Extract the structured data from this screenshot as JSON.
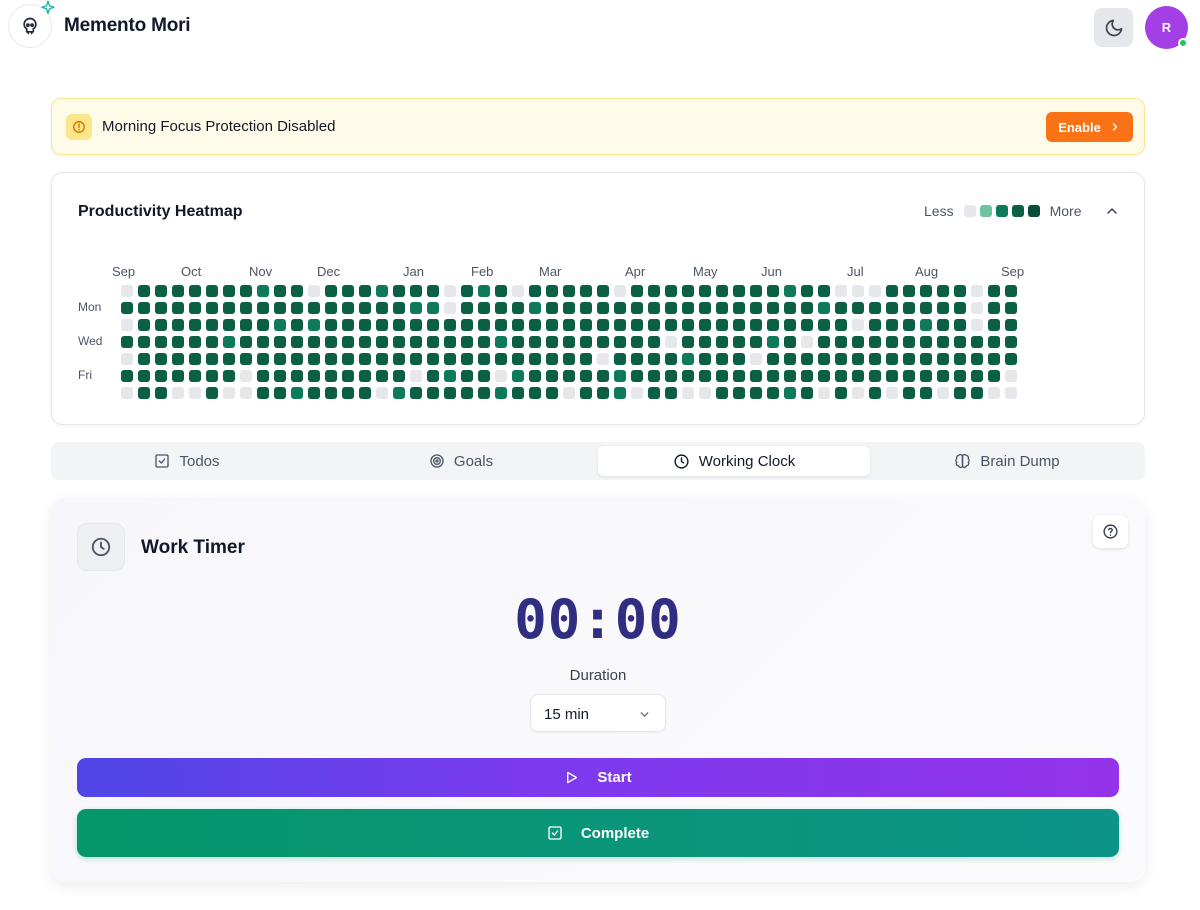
{
  "app": {
    "title": "Memento Mori",
    "avatar_initial": "R"
  },
  "colors": {
    "accent_orange": "#f97316",
    "heat_levels": [
      "#e5e7eb",
      "#6fc3a0",
      "#0f7a5a",
      "#0b5f45",
      "#064e3b"
    ]
  },
  "alert": {
    "text": "Morning Focus Protection Disabled",
    "button_label": "Enable"
  },
  "heatmap": {
    "title": "Productivity Heatmap",
    "legend_less": "Less",
    "legend_more": "More",
    "months": [
      "Sep",
      "Oct",
      "Nov",
      "Dec",
      "Jan",
      "Feb",
      "Mar",
      "Apr",
      "May",
      "Jun",
      "Jul",
      "Aug",
      "Sep"
    ],
    "day_labels": [
      "Mon",
      "Wed",
      "Fri"
    ],
    "weeks": [
      [
        0,
        3,
        0,
        3,
        0,
        3,
        0
      ],
      [
        3,
        3,
        3,
        3,
        3,
        3,
        3
      ],
      [
        3,
        3,
        3,
        3,
        3,
        3,
        3
      ],
      [
        3,
        3,
        3,
        3,
        3,
        3,
        0
      ],
      [
        3,
        3,
        3,
        3,
        3,
        3,
        0
      ],
      [
        3,
        3,
        3,
        3,
        3,
        3,
        3
      ],
      [
        3,
        3,
        3,
        2,
        3,
        3,
        0
      ],
      [
        3,
        3,
        3,
        3,
        3,
        0,
        0
      ],
      [
        2,
        3,
        3,
        3,
        3,
        3,
        3
      ],
      [
        3,
        3,
        2,
        3,
        3,
        3,
        3
      ],
      [
        3,
        3,
        3,
        3,
        3,
        3,
        2
      ],
      [
        0,
        3,
        2,
        3,
        3,
        3,
        3
      ],
      [
        3,
        3,
        3,
        3,
        3,
        3,
        3
      ],
      [
        3,
        3,
        3,
        3,
        3,
        3,
        3
      ],
      [
        3,
        3,
        3,
        3,
        3,
        3,
        3
      ],
      [
        2,
        3,
        3,
        3,
        3,
        3,
        0
      ],
      [
        3,
        3,
        3,
        3,
        3,
        3,
        2
      ],
      [
        3,
        2,
        3,
        3,
        3,
        0,
        3
      ],
      [
        3,
        2,
        3,
        3,
        3,
        3,
        3
      ],
      [
        0,
        0,
        3,
        3,
        3,
        2,
        3
      ],
      [
        3,
        3,
        3,
        3,
        3,
        3,
        3
      ],
      [
        2,
        3,
        3,
        3,
        3,
        3,
        3
      ],
      [
        3,
        3,
        3,
        2,
        3,
        0,
        2
      ],
      [
        0,
        3,
        3,
        3,
        3,
        2,
        3
      ],
      [
        3,
        2,
        3,
        3,
        3,
        3,
        3
      ],
      [
        3,
        3,
        3,
        3,
        3,
        3,
        3
      ],
      [
        3,
        3,
        3,
        3,
        3,
        3,
        0
      ],
      [
        3,
        3,
        3,
        3,
        3,
        3,
        3
      ],
      [
        3,
        3,
        3,
        3,
        0,
        3,
        3
      ],
      [
        0,
        3,
        3,
        3,
        3,
        2,
        2
      ],
      [
        3,
        3,
        3,
        3,
        3,
        3,
        0
      ],
      [
        3,
        3,
        3,
        3,
        3,
        3,
        3
      ],
      [
        3,
        3,
        3,
        0,
        3,
        3,
        3
      ],
      [
        3,
        3,
        3,
        3,
        2,
        3,
        0
      ],
      [
        3,
        3,
        3,
        3,
        3,
        3,
        0
      ],
      [
        3,
        3,
        3,
        3,
        3,
        3,
        3
      ],
      [
        3,
        3,
        3,
        3,
        3,
        3,
        3
      ],
      [
        3,
        3,
        3,
        3,
        0,
        3,
        3
      ],
      [
        3,
        3,
        3,
        2,
        3,
        3,
        3
      ],
      [
        2,
        3,
        3,
        3,
        3,
        3,
        2
      ],
      [
        3,
        3,
        3,
        0,
        3,
        3,
        3
      ],
      [
        3,
        2,
        3,
        3,
        3,
        3,
        0
      ],
      [
        0,
        3,
        3,
        3,
        3,
        3,
        3
      ],
      [
        0,
        3,
        0,
        3,
        3,
        3,
        0
      ],
      [
        0,
        3,
        3,
        3,
        3,
        3,
        3
      ],
      [
        3,
        3,
        3,
        3,
        3,
        3,
        0
      ],
      [
        3,
        3,
        3,
        3,
        3,
        3,
        3
      ],
      [
        3,
        3,
        2,
        3,
        3,
        3,
        3
      ],
      [
        3,
        3,
        3,
        3,
        3,
        3,
        0
      ],
      [
        3,
        3,
        3,
        3,
        3,
        3,
        3
      ],
      [
        0,
        0,
        0,
        3,
        3,
        3,
        3
      ],
      [
        3,
        3,
        3,
        3,
        3,
        3,
        0
      ],
      [
        3,
        3,
        3,
        3,
        3,
        0,
        0
      ]
    ]
  },
  "tabs": [
    {
      "label": "Todos",
      "icon": "check-square-icon"
    },
    {
      "label": "Goals",
      "icon": "target-icon"
    },
    {
      "label": "Working Clock",
      "icon": "clock-icon",
      "active": true
    },
    {
      "label": "Brain Dump",
      "icon": "brain-icon"
    }
  ],
  "timer": {
    "title": "Work Timer",
    "time": "00:00",
    "duration_label": "Duration",
    "duration_value": "15 min",
    "start_label": "Start",
    "complete_label": "Complete"
  }
}
